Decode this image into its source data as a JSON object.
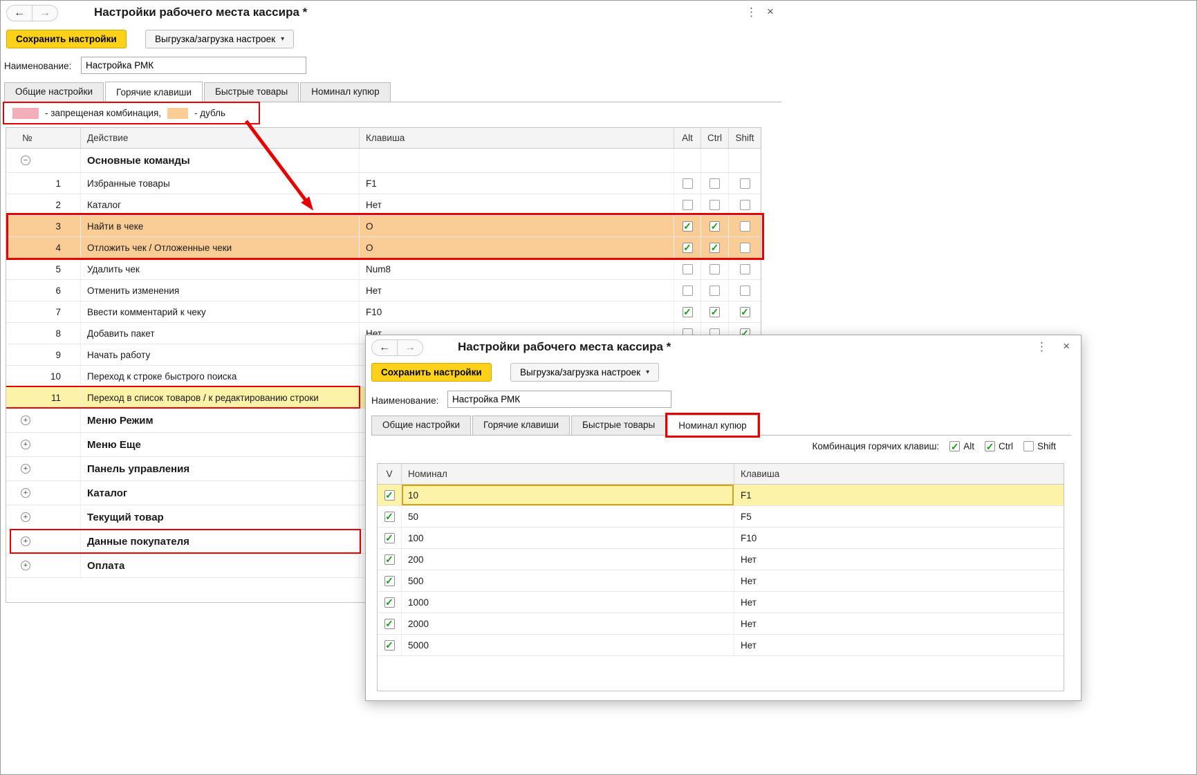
{
  "colors": {
    "annotation_red": "#e60000",
    "primary_button": "#ffd119",
    "duplicate_row": "#fbcd96",
    "forbidden_swatch": "#f3aebc",
    "selected_row": "#fdf3a8",
    "check_green": "#169c16"
  },
  "icons": {
    "back": "←",
    "forward": "→",
    "menu": "⋮",
    "close": "×",
    "dropdown": "▾",
    "check": "✓",
    "expand_open": "−",
    "expand_closed": "+"
  },
  "main_window": {
    "title": "Настройки рабочего места кассира *",
    "toolbar": {
      "save_label": "Сохранить настройки",
      "export_label": "Выгрузка/загрузка настроек"
    },
    "name_field": {
      "label": "Наименование:",
      "value": "Настройка РМК"
    },
    "tabs": [
      {
        "label": "Общие настройки"
      },
      {
        "label": "Горячие клавиши"
      },
      {
        "label": "Быстрые товары"
      },
      {
        "label": "Номинал купюр"
      }
    ],
    "legend": {
      "forbidden_label": "- запрещеная комбинация,",
      "duplicate_label": "- дубль"
    },
    "hotkeys_table": {
      "headers": [
        "№",
        "Действие",
        "Клавиша",
        "Alt",
        "Ctrl",
        "Shift"
      ],
      "rows": [
        {
          "type": "group",
          "expanded": true,
          "action": "Основные команды"
        },
        {
          "type": "item",
          "num": "1",
          "action": "Избранные товары",
          "key": "F1",
          "alt": false,
          "ctrl": false,
          "shift": false
        },
        {
          "type": "item",
          "num": "2",
          "action": "Каталог",
          "key": "Нет",
          "alt": false,
          "ctrl": false,
          "shift": false
        },
        {
          "type": "item",
          "num": "3",
          "action": "Найти в чеке",
          "key": "O",
          "alt": true,
          "ctrl": true,
          "shift": false,
          "highlight": "duplicate"
        },
        {
          "type": "item",
          "num": "4",
          "action": "Отложить чек / Отложенные чеки",
          "key": "O",
          "alt": true,
          "ctrl": true,
          "shift": false,
          "highlight": "duplicate"
        },
        {
          "type": "item",
          "num": "5",
          "action": "Удалить чек",
          "key": "Num8",
          "alt": false,
          "ctrl": false,
          "shift": false
        },
        {
          "type": "item",
          "num": "6",
          "action": "Отменить изменения",
          "key": "Нет",
          "alt": false,
          "ctrl": false,
          "shift": false
        },
        {
          "type": "item",
          "num": "7",
          "action": "Ввести комментарий к чеку",
          "key": "F10",
          "alt": true,
          "ctrl": true,
          "shift": true
        },
        {
          "type": "item",
          "num": "8",
          "action": "Добавить пакет",
          "key": "Нет",
          "alt": false,
          "ctrl": false,
          "shift": true
        },
        {
          "type": "item",
          "num": "9",
          "action": "Начать работу",
          "key": "",
          "alt": false,
          "ctrl": false,
          "shift": false
        },
        {
          "type": "item",
          "num": "10",
          "action": "Переход к строке быстрого поиска",
          "key": "",
          "alt": false,
          "ctrl": false,
          "shift": false
        },
        {
          "type": "item",
          "num": "11",
          "action": "Переход в список товаров / к редактированию строки",
          "key": "",
          "alt": false,
          "ctrl": false,
          "shift": false,
          "highlight": "selected",
          "annotated": true
        },
        {
          "type": "group",
          "expanded": false,
          "action": "Меню Режим"
        },
        {
          "type": "group",
          "expanded": false,
          "action": "Меню Еще"
        },
        {
          "type": "group",
          "expanded": false,
          "action": "Панель управления"
        },
        {
          "type": "group",
          "expanded": false,
          "action": "Каталог"
        },
        {
          "type": "group",
          "expanded": false,
          "action": "Текущий товар"
        },
        {
          "type": "group",
          "expanded": false,
          "action": "Данные покупателя",
          "annotated": true
        },
        {
          "type": "group",
          "expanded": false,
          "action": "Оплата"
        }
      ]
    }
  },
  "front_window": {
    "title": "Настройки рабочего места кассира *",
    "toolbar": {
      "save_label": "Сохранить настройки",
      "export_label": "Выгрузка/загрузка настроек"
    },
    "name_field": {
      "label": "Наименование:",
      "value": "Настройка РМК"
    },
    "tabs": [
      {
        "label": "Общие настройки"
      },
      {
        "label": "Горячие клавиши"
      },
      {
        "label": "Быстрые товары"
      },
      {
        "label": "Номинал купюр",
        "active": true,
        "annotated": true
      }
    ],
    "hotkey_combo": {
      "label": "Комбинация горячих клавиш:",
      "options": [
        {
          "label": "Alt",
          "checked": true
        },
        {
          "label": "Ctrl",
          "checked": true
        },
        {
          "label": "Shift",
          "checked": false
        }
      ]
    },
    "nominal_table": {
      "headers": [
        "V",
        "Номинал",
        "Клавиша"
      ],
      "rows": [
        {
          "checked": true,
          "nominal": "10",
          "key": "F1",
          "selected": true
        },
        {
          "checked": true,
          "nominal": "50",
          "key": "F5"
        },
        {
          "checked": true,
          "nominal": "100",
          "key": "F10"
        },
        {
          "checked": true,
          "nominal": "200",
          "key": "Нет"
        },
        {
          "checked": true,
          "nominal": "500",
          "key": "Нет"
        },
        {
          "checked": true,
          "nominal": "1000",
          "key": "Нет"
        },
        {
          "checked": true,
          "nominal": "2000",
          "key": "Нет"
        },
        {
          "checked": true,
          "nominal": "5000",
          "key": "Нет"
        }
      ]
    }
  }
}
